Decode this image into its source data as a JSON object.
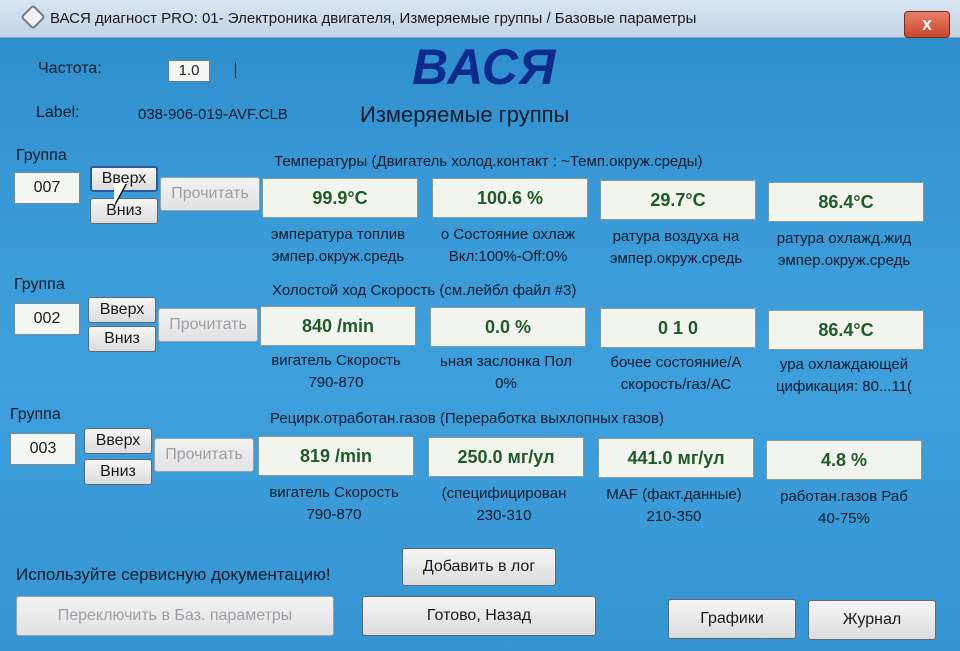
{
  "window": {
    "title": "ВАСЯ диагност PRO: 01- Электроника двигателя,  Измеряемые группы / Базовые параметры",
    "close_label": "x"
  },
  "header": {
    "freq_label": "Частота:",
    "freq_value": "1.0",
    "label_label": "Label:",
    "label_value": "038-906-019-AVF.CLB",
    "logo": "ВАСЯ",
    "section_title": "Измеряемые группы"
  },
  "groups": [
    {
      "label": "Группа",
      "number": "007",
      "up": "Вверх",
      "down": "Вниз",
      "read": "Прочитать",
      "title": "Температуры (Двигатель холод.контакт : ~Темп.окруж.среды)",
      "fields": [
        {
          "value": "99.9°C",
          "desc1": "эмпература топлив",
          "desc2": "эмпер.окруж.средь"
        },
        {
          "value": "100.6 %",
          "desc1": "о Состояние охлаж",
          "desc2": "Вкл:100%-Off:0%"
        },
        {
          "value": "29.7°C",
          "desc1": "ратура воздуха на",
          "desc2": "эмпер.окруж.средь"
        },
        {
          "value": "86.4°C",
          "desc1": "ратура охлажд.жид",
          "desc2": "эмпер.окруж.средь"
        }
      ]
    },
    {
      "label": "Группа",
      "number": "002",
      "up": "Вверх",
      "down": "Вниз",
      "read": "Прочитать",
      "title": "Холостой ход Скорость (см.лейбл файл #3)",
      "fields": [
        {
          "value": "840 /min",
          "desc1": "вигатель Скорость",
          "desc2": "790-870"
        },
        {
          "value": "0.0 %",
          "desc1": "ьная заслонка Пол",
          "desc2": "0%"
        },
        {
          "value": "0  1  0",
          "desc1": "бочее состояние/А",
          "desc2": "скорость/газ/АС"
        },
        {
          "value": "86.4°C",
          "desc1": "ура охлаждающей",
          "desc2": "цификация: 80...11("
        }
      ]
    },
    {
      "label": "Группа",
      "number": "003",
      "up": "Вверх",
      "down": "Вниз",
      "read": "Прочитать",
      "title": "Рецирк.отработан.газов (Переработка выхлопных газов)",
      "fields": [
        {
          "value": "819 /min",
          "desc1": "вигатель Скорость",
          "desc2": "790-870"
        },
        {
          "value": "250.0 мг/ул",
          "desc1": "(специфицирован",
          "desc2": "230-310"
        },
        {
          "value": "441.0 мг/ул",
          "desc1": "MAF (факт.данные)",
          "desc2": "210-350"
        },
        {
          "value": "4.8 %",
          "desc1": "работан.газов Раб",
          "desc2": "40-75%"
        }
      ]
    }
  ],
  "footer": {
    "hint": "Используйте сервисную документацию!",
    "add_log": "Добавить в лог",
    "switch_base": "Переключить в Баз. параметры",
    "done_back": "Готово, Назад",
    "graphs": "Графики",
    "journal": "Журнал"
  }
}
